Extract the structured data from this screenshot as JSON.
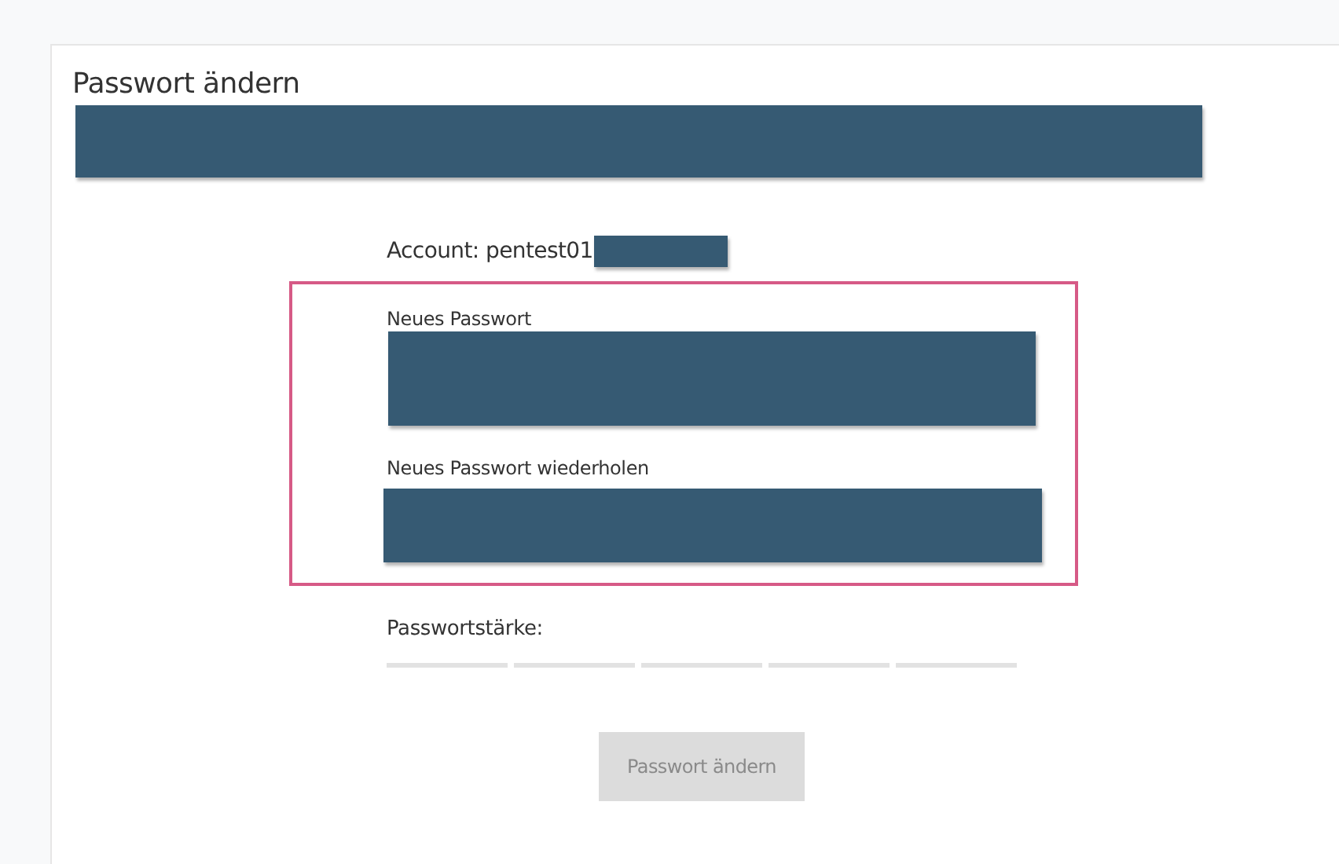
{
  "panel": {
    "title": "Passwort ändern",
    "subtitle_redacted": true
  },
  "account": {
    "text": "Account: pentest01",
    "redacted": true
  },
  "fields": [
    {
      "label": "Neues Passwort",
      "redacted": true
    },
    {
      "label": "Neues Passwort wiederholen",
      "redacted": true
    }
  ],
  "strength": {
    "label": "Passwortstärke:"
  },
  "submit": {
    "label": "Passwort ändern",
    "disabled": true
  }
}
